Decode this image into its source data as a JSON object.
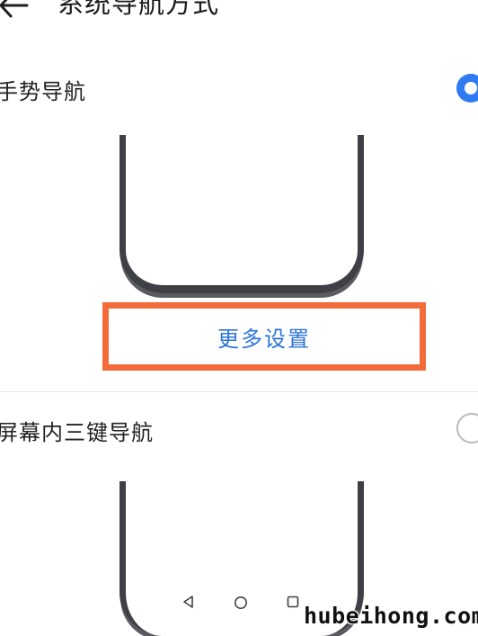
{
  "header": {
    "title": "系统导航方式",
    "back_icon": "arrow-left-icon"
  },
  "options": [
    {
      "label": "手势导航",
      "selected": true,
      "action": "更多设置"
    },
    {
      "label": "屏幕内三键导航",
      "selected": false,
      "keys": [
        "back-triangle-icon",
        "home-circle-icon",
        "recents-square-icon"
      ]
    }
  ],
  "colors": {
    "accent": "#2f7bf1",
    "link": "#2e74d9",
    "highlight_box": "#f26b38"
  },
  "watermark": "hubeihong.com"
}
